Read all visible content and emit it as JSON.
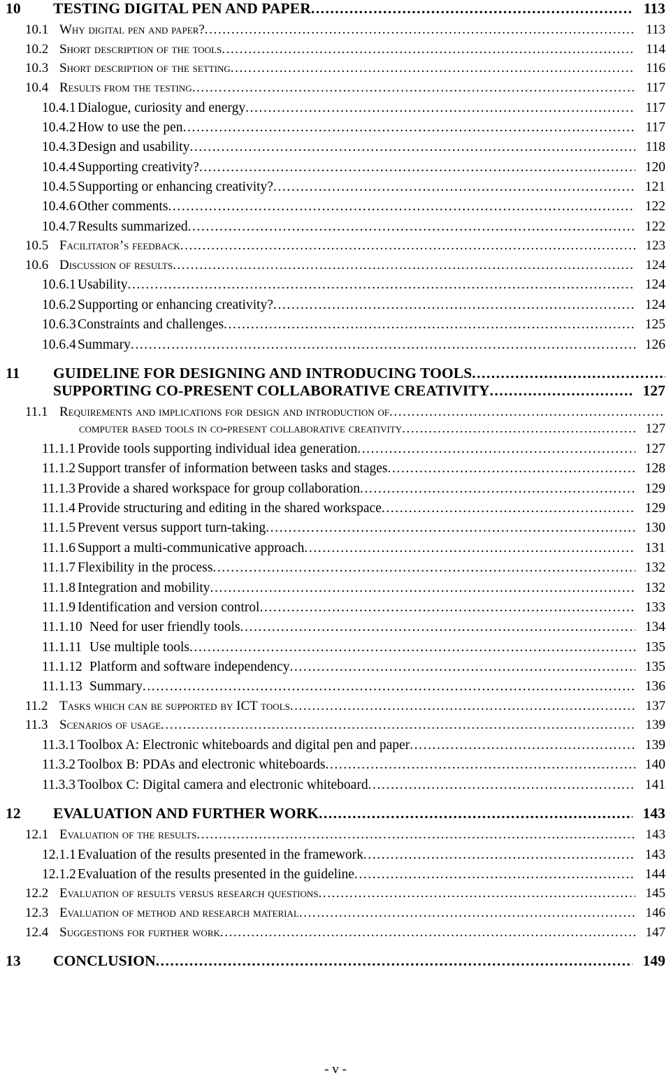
{
  "page": {
    "footer": "- v -"
  },
  "toc": {
    "entries": [
      {
        "level": 1,
        "number": "10",
        "title": "TESTING DIGITAL PEN AND PAPER",
        "page": "113"
      },
      {
        "level": 2,
        "number": "10.1",
        "title": "Why digital pen and paper?",
        "page": "113"
      },
      {
        "level": 2,
        "number": "10.2",
        "title": "Short description of the tools",
        "page": "114"
      },
      {
        "level": 2,
        "number": "10.3",
        "title": "Short description of the setting",
        "page": "116"
      },
      {
        "level": 2,
        "number": "10.4",
        "title": "Results from the testing",
        "page": "117"
      },
      {
        "level": 3,
        "number": "10.4.1",
        "title": "Dialogue, curiosity and energy",
        "page": "117"
      },
      {
        "level": 3,
        "number": "10.4.2",
        "title": "How to use the pen",
        "page": "117"
      },
      {
        "level": 3,
        "number": "10.4.3",
        "title": "Design and usability",
        "page": "118"
      },
      {
        "level": 3,
        "number": "10.4.4",
        "title": "Supporting creativity?",
        "page": "120"
      },
      {
        "level": 3,
        "number": "10.4.5",
        "title": "Supporting or enhancing creativity?",
        "page": "121"
      },
      {
        "level": 3,
        "number": "10.4.6",
        "title": "Other comments",
        "page": "122"
      },
      {
        "level": 3,
        "number": "10.4.7",
        "title": "Results summarized",
        "page": "122"
      },
      {
        "level": 2,
        "number": "10.5",
        "title": "Facilitator’s feedback",
        "page": "123"
      },
      {
        "level": 2,
        "number": "10.6",
        "title": "Discussion of results",
        "page": "124"
      },
      {
        "level": 3,
        "number": "10.6.1",
        "title": "Usability",
        "page": "124"
      },
      {
        "level": 3,
        "number": "10.6.2",
        "title": "Supporting or enhancing creativity?",
        "page": "124"
      },
      {
        "level": 3,
        "number": "10.6.3",
        "title": "Constraints and challenges",
        "page": "125"
      },
      {
        "level": 3,
        "number": "10.6.4",
        "title": "Summary",
        "page": "126"
      },
      {
        "level": 1,
        "number": "11",
        "title": "GUIDELINE FOR DESIGNING AND INTRODUCING TOOLS",
        "title2": "SUPPORTING CO-PRESENT COLLABORATIVE CREATIVITY",
        "page": "127"
      },
      {
        "level": 2,
        "number": "11.1",
        "title": "Requirements and implications for design and  introduction of",
        "title2": "computer based tools in co-present collaborative creativity",
        "page": "127"
      },
      {
        "level": 3,
        "number": "11.1.1",
        "title": "Provide tools supporting individual idea generation",
        "page": "127"
      },
      {
        "level": 3,
        "number": "11.1.2",
        "title": "Support transfer of information between tasks and stages",
        "page": "128"
      },
      {
        "level": 3,
        "number": "11.1.3",
        "title": "Provide a shared workspace for group collaboration",
        "page": "129"
      },
      {
        "level": 3,
        "number": "11.1.4",
        "title": "Provide structuring and editing in the shared workspace",
        "page": "129"
      },
      {
        "level": 3,
        "number": "11.1.5",
        "title": "Prevent versus support turn-taking",
        "page": "130"
      },
      {
        "level": 3,
        "number": "11.1.6",
        "title": "Support a multi-communicative approach",
        "page": "131"
      },
      {
        "level": 3,
        "number": "11.1.7",
        "title": "Flexibility in the process",
        "page": "132"
      },
      {
        "level": 3,
        "number": "11.1.8",
        "title": "Integration and mobility",
        "page": "132"
      },
      {
        "level": 3,
        "number": "11.1.9",
        "title": "Identification and version control",
        "page": "133"
      },
      {
        "level": 3,
        "number": "11.1.10",
        "title": "Need for user friendly tools",
        "page": "134",
        "wide": true
      },
      {
        "level": 3,
        "number": "11.1.11",
        "title": "Use multiple tools",
        "page": "135",
        "wide": true
      },
      {
        "level": 3,
        "number": "11.1.12",
        "title": "Platform and software independency",
        "page": "135",
        "wide": true
      },
      {
        "level": 3,
        "number": "11.1.13",
        "title": "Summary",
        "page": "136",
        "wide": true
      },
      {
        "level": 2,
        "number": "11.2",
        "title": "Tasks which can be supported by ICT tools",
        "page": "137"
      },
      {
        "level": 2,
        "number": "11.3",
        "title": "Scenarios of usage",
        "page": "139"
      },
      {
        "level": 3,
        "number": "11.3.1",
        "title": "Toolbox A: Electronic whiteboards and digital pen and paper",
        "page": "139"
      },
      {
        "level": 3,
        "number": "11.3.2",
        "title": "Toolbox B: PDAs and electronic whiteboards",
        "page": "140"
      },
      {
        "level": 3,
        "number": "11.3.3",
        "title": "Toolbox C: Digital camera and electronic whiteboard",
        "page": "141"
      },
      {
        "level": 1,
        "number": "12",
        "title": "EVALUATION AND FURTHER WORK",
        "page": "143"
      },
      {
        "level": 2,
        "number": "12.1",
        "title": "Evaluation of the results",
        "page": "143"
      },
      {
        "level": 3,
        "number": "12.1.1",
        "title": "Evaluation of the results presented in the framework",
        "page": "143"
      },
      {
        "level": 3,
        "number": "12.1.2",
        "title": "Evaluation of the results presented in the guideline",
        "page": "144"
      },
      {
        "level": 2,
        "number": "12.2",
        "title": "Evaluation of results versus research questions",
        "page": "145"
      },
      {
        "level": 2,
        "number": "12.3",
        "title": "Evaluation of method and research material",
        "page": "146"
      },
      {
        "level": 2,
        "number": "12.4",
        "title": "Suggestions for further work",
        "page": "147"
      },
      {
        "level": 1,
        "number": "13",
        "title": "CONCLUSION",
        "page": "149"
      }
    ]
  }
}
